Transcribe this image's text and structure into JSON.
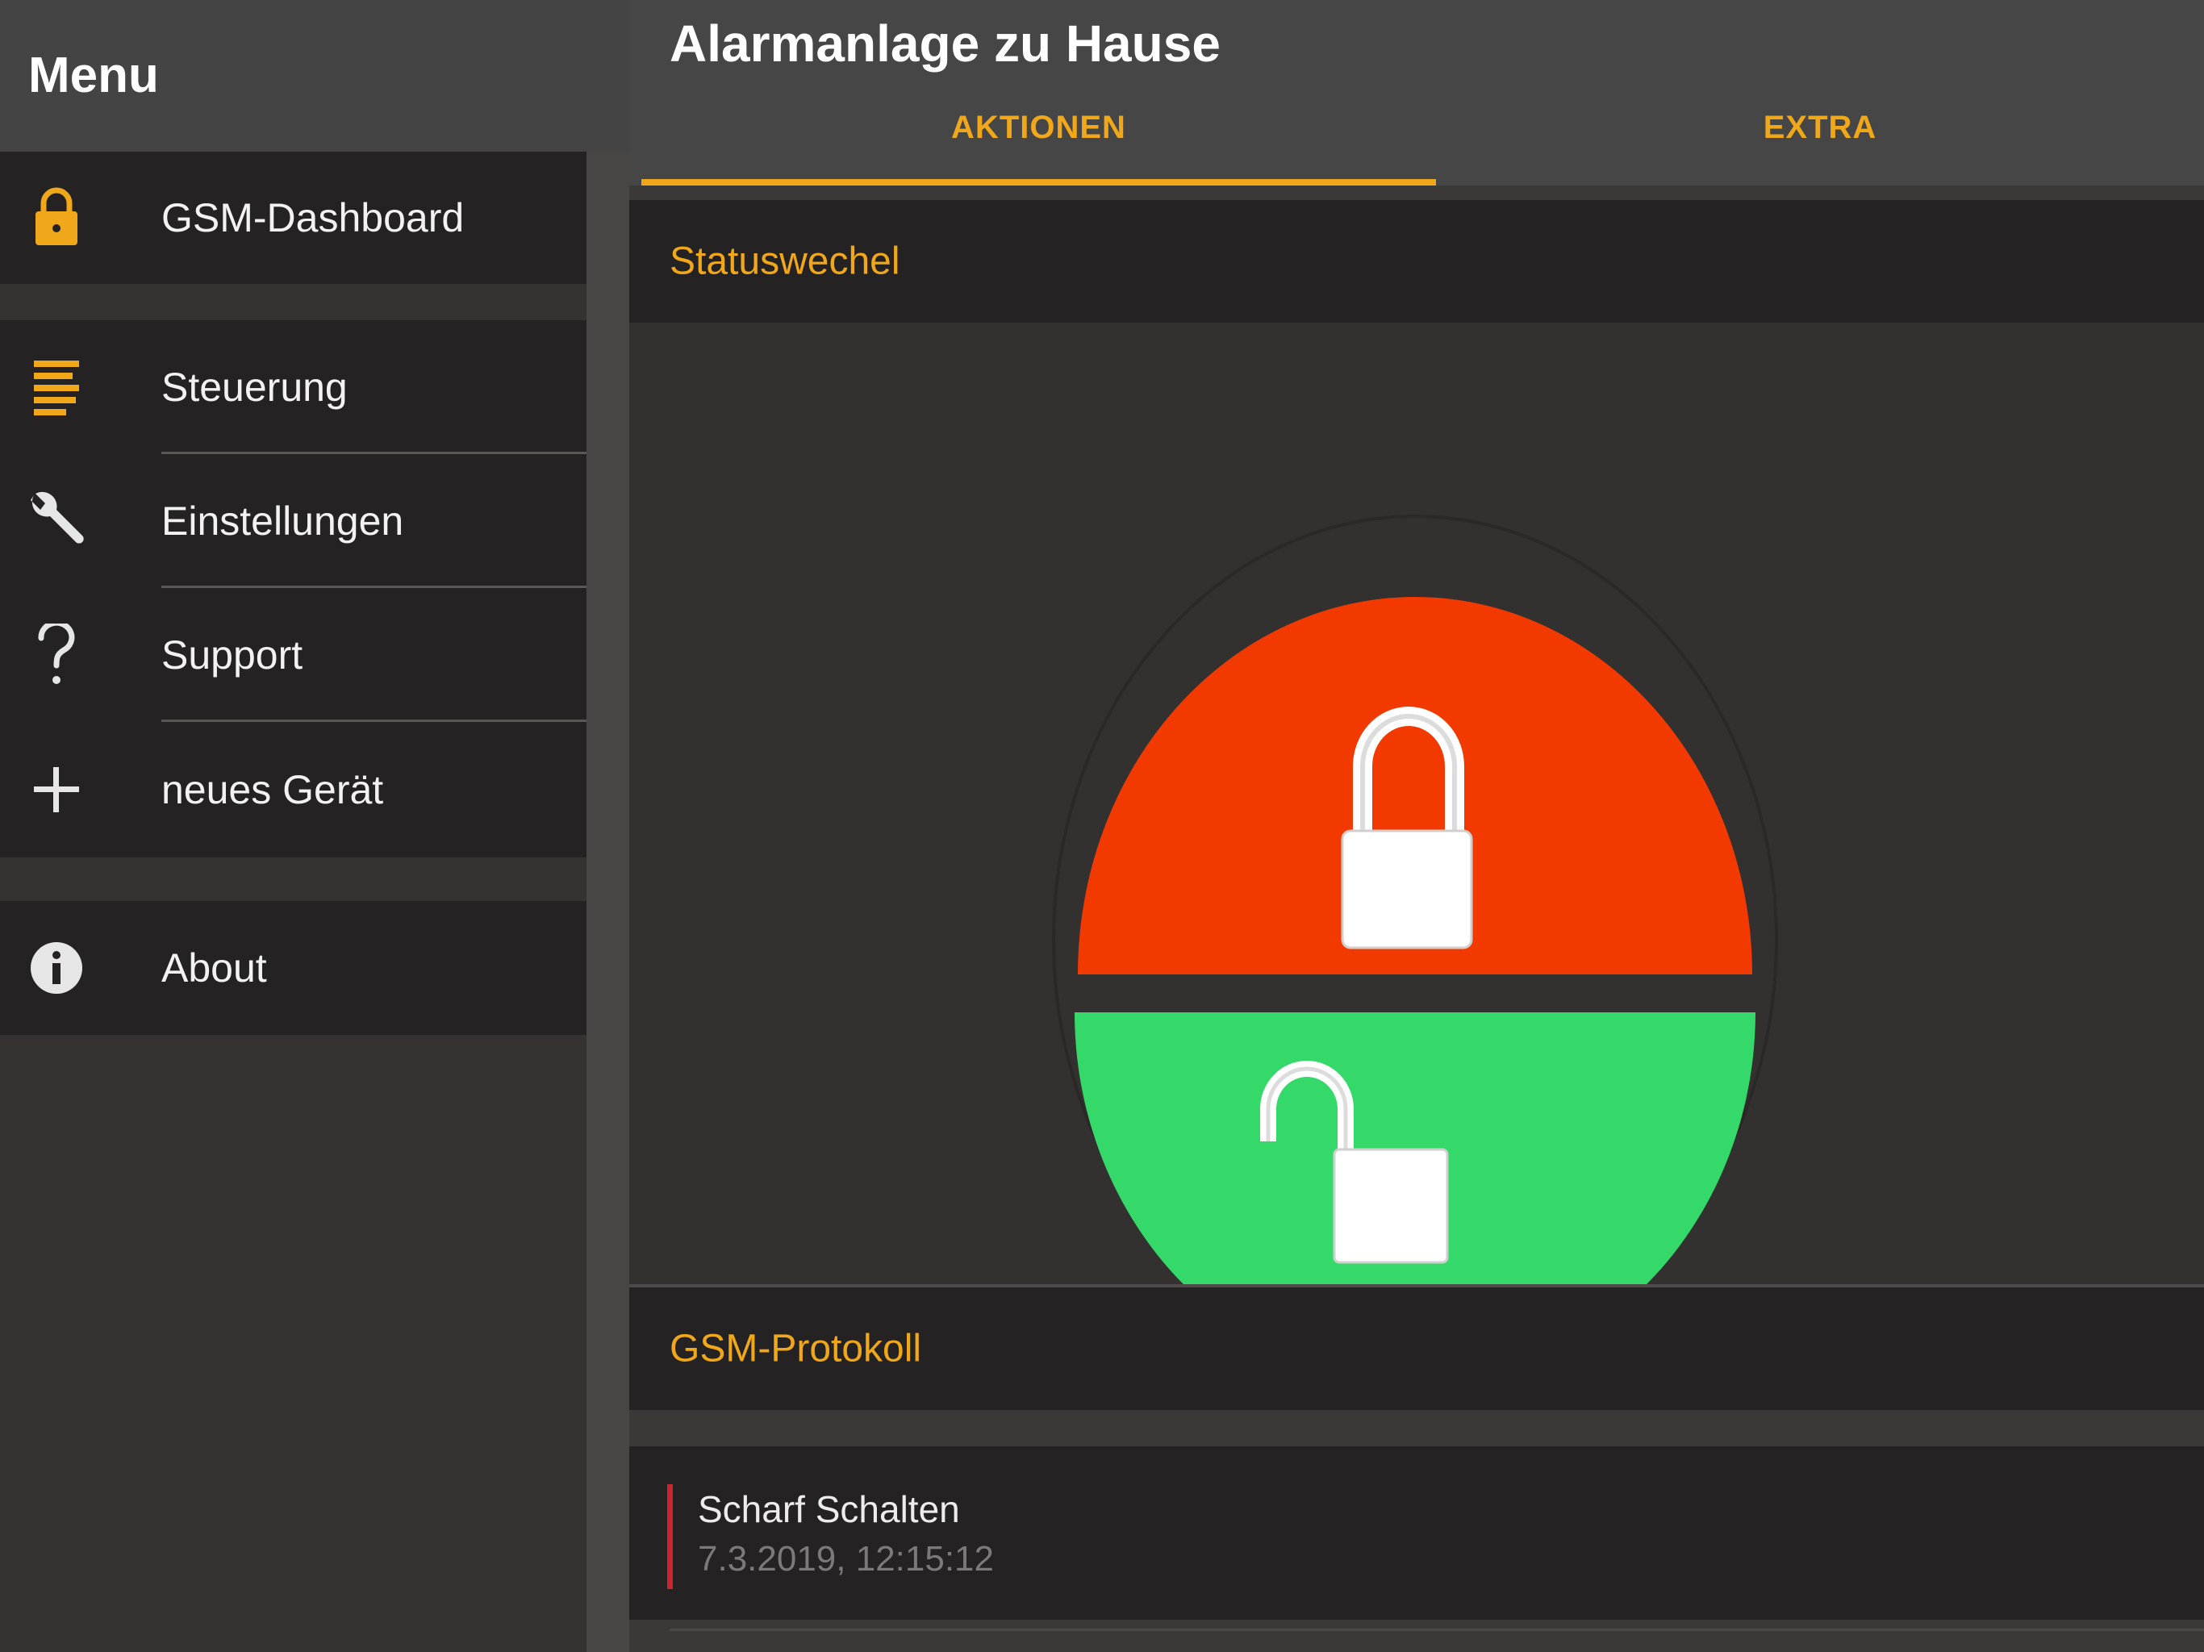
{
  "sidebar": {
    "title": "Menu",
    "items": [
      {
        "label": "GSM-Dashboard",
        "icon": "lock-icon"
      },
      {
        "label": "Steuerung",
        "icon": "list-icon"
      },
      {
        "label": "Einstellungen",
        "icon": "wrench-icon"
      },
      {
        "label": "Support",
        "icon": "question-icon"
      },
      {
        "label": "neues Gerät",
        "icon": "plus-icon"
      },
      {
        "label": "About",
        "icon": "info-icon"
      }
    ]
  },
  "header": {
    "title": "Alarmanlage zu Hause",
    "tabs": [
      {
        "label": "AKTIONEN",
        "active": true
      },
      {
        "label": "EXTRA",
        "active": false
      }
    ]
  },
  "status_section": {
    "title": "Statuswechel",
    "buttons": [
      {
        "icon": "lock-closed-icon",
        "color": "#f23a00"
      },
      {
        "icon": "lock-open-icon",
        "color": "#35d96a"
      }
    ]
  },
  "protocol_section": {
    "title": "GSM-Protokoll",
    "entries": [
      {
        "event": "Scharf Schalten",
        "time": "7.3.2019, 12:15:12",
        "marker_color": "#cc2431"
      }
    ]
  },
  "colors": {
    "accent": "#f0a81a",
    "sidebar_bg": "#353231",
    "panel_bg": "#242222",
    "topbar_bg": "#464646"
  }
}
